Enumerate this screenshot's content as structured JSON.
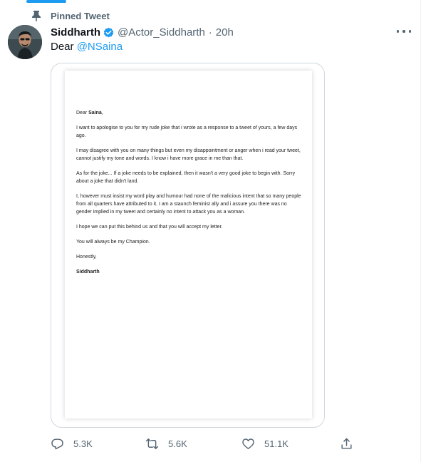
{
  "pinned": {
    "label": "Pinned Tweet"
  },
  "tweet": {
    "display_name": "Siddharth",
    "handle": "@Actor_Siddharth",
    "separator": "·",
    "time": "20h",
    "text_prefix": "Dear ",
    "mention": "@NSaina"
  },
  "letter": {
    "salutation_prefix": "Dear ",
    "salutation_name": "Saina",
    "salutation_suffix": ",",
    "paragraphs": [
      "I want to apologise to you for my rude joke that i wrote as a response to a tweet of yours, a few days ago.",
      "I may disagree with you on many things but even my disappointment or anger when i read your tweet, cannot justify my tone and words. I know i have more grace in me than that.",
      "As for the joke... If a joke needs to be explained, then it wasn't a very good joke to begin with. Sorry about a joke that didn't land.",
      "I, however must insist my word play and humour had none of the malicious intent that so many people from all quarters have attributed to it. I am a staunch feminist ally and i assure you there was no gender implied in my tweet and certainly no intent to attack you as a woman.",
      "I hope we can put this behind us and that you will accept my letter.",
      "You will always be my Champion."
    ],
    "closing": "Honestly,",
    "signature": "Siddharth"
  },
  "actions": {
    "replies": "5.3K",
    "retweets": "5.6K",
    "likes": "51.1K"
  },
  "colors": {
    "accent": "#1d9bf0",
    "secondary_text": "#536471",
    "primary_text": "#0f1419",
    "border": "#cfd9de"
  },
  "icons": [
    "pin-icon",
    "verified-icon",
    "more-icon",
    "reply-icon",
    "retweet-icon",
    "like-icon",
    "share-icon"
  ]
}
